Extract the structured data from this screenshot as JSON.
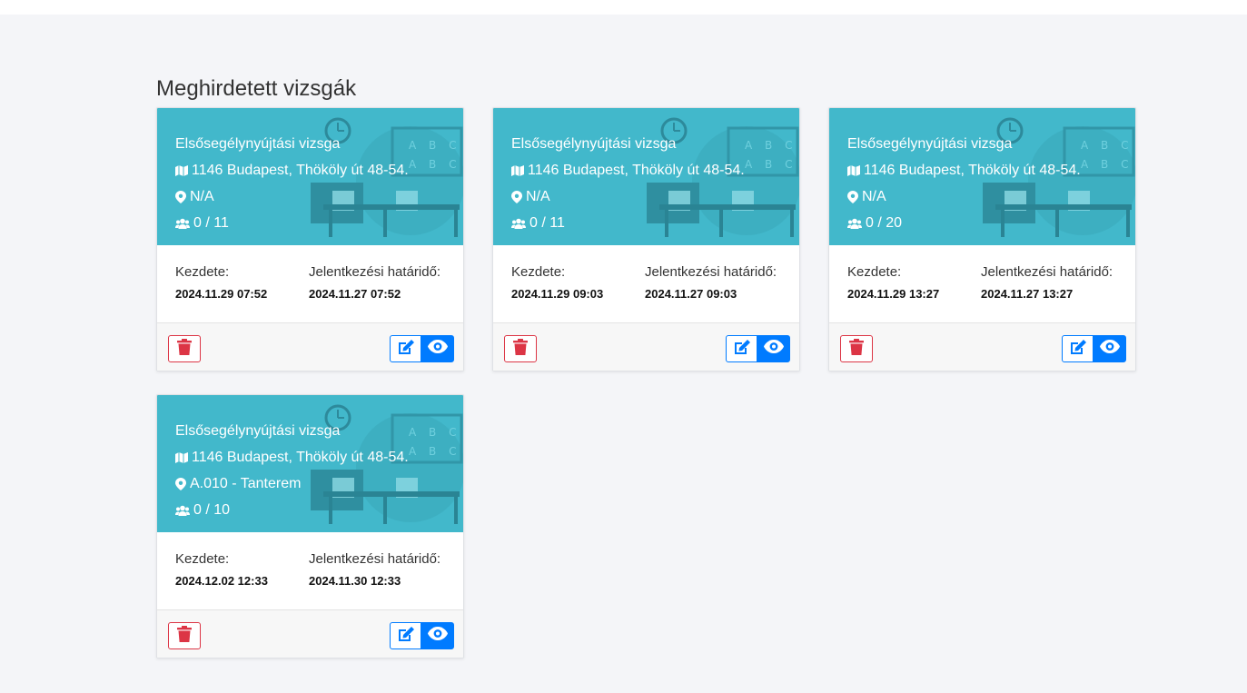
{
  "page": {
    "title": "Meghirdetett vizsgák"
  },
  "colors": {
    "header_bg": "#42b8cb",
    "danger": "#dc3545",
    "primary": "#007bff"
  },
  "labels": {
    "start": "Kezdete:",
    "deadline": "Jelentkezési határidő:"
  },
  "cards": [
    {
      "name": "Elsősegélynyújtási vizsga",
      "address": "1146 Budapest, Thököly út 48-54.",
      "room": "N/A",
      "capacity": "0 / 11",
      "start": "2024.11.29 07:52",
      "deadline": "2024.11.27 07:52"
    },
    {
      "name": "Elsősegélynyújtási vizsga",
      "address": "1146 Budapest, Thököly út 48-54.",
      "room": "N/A",
      "capacity": "0 / 11",
      "start": "2024.11.29 09:03",
      "deadline": "2024.11.27 09:03"
    },
    {
      "name": "Elsősegélynyújtási vizsga",
      "address": "1146 Budapest, Thököly út 48-54.",
      "room": "N/A",
      "capacity": "0 / 20",
      "start": "2024.11.29 13:27",
      "deadline": "2024.11.27 13:27"
    },
    {
      "name": "Elsősegélynyújtási vizsga",
      "address": "1146 Budapest, Thököly út 48-54.",
      "room": "A.010 - Tanterem",
      "capacity": "0 / 10",
      "start": "2024.12.02 12:33",
      "deadline": "2024.11.30 12:33"
    }
  ],
  "icons": {
    "address": "map-icon",
    "room": "map-marker-icon",
    "capacity": "users-icon",
    "delete": "trash-icon",
    "edit": "edit-icon",
    "view": "eye-icon"
  }
}
